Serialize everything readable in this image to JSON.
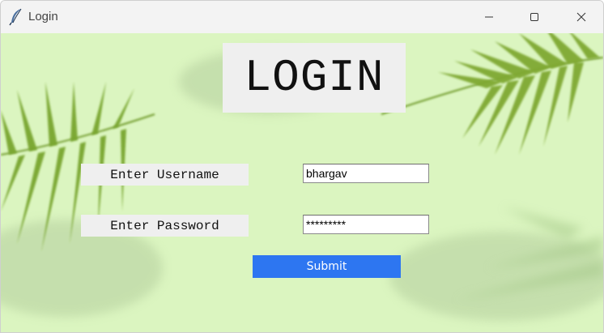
{
  "window": {
    "title": "Login",
    "icon": "feather-icon",
    "controls": [
      "minimize-icon",
      "maximize-icon",
      "close-icon"
    ]
  },
  "form": {
    "heading": "LOGIN",
    "username_label": "Enter Username",
    "username_value": "bhargav",
    "password_label": "Enter Password",
    "password_value": "*********",
    "submit_label": "Submit"
  },
  "colors": {
    "background": "#dbf5c0",
    "label_bg": "#efefef",
    "submit_bg": "#2d76f1",
    "submit_text": "#ffffff"
  }
}
